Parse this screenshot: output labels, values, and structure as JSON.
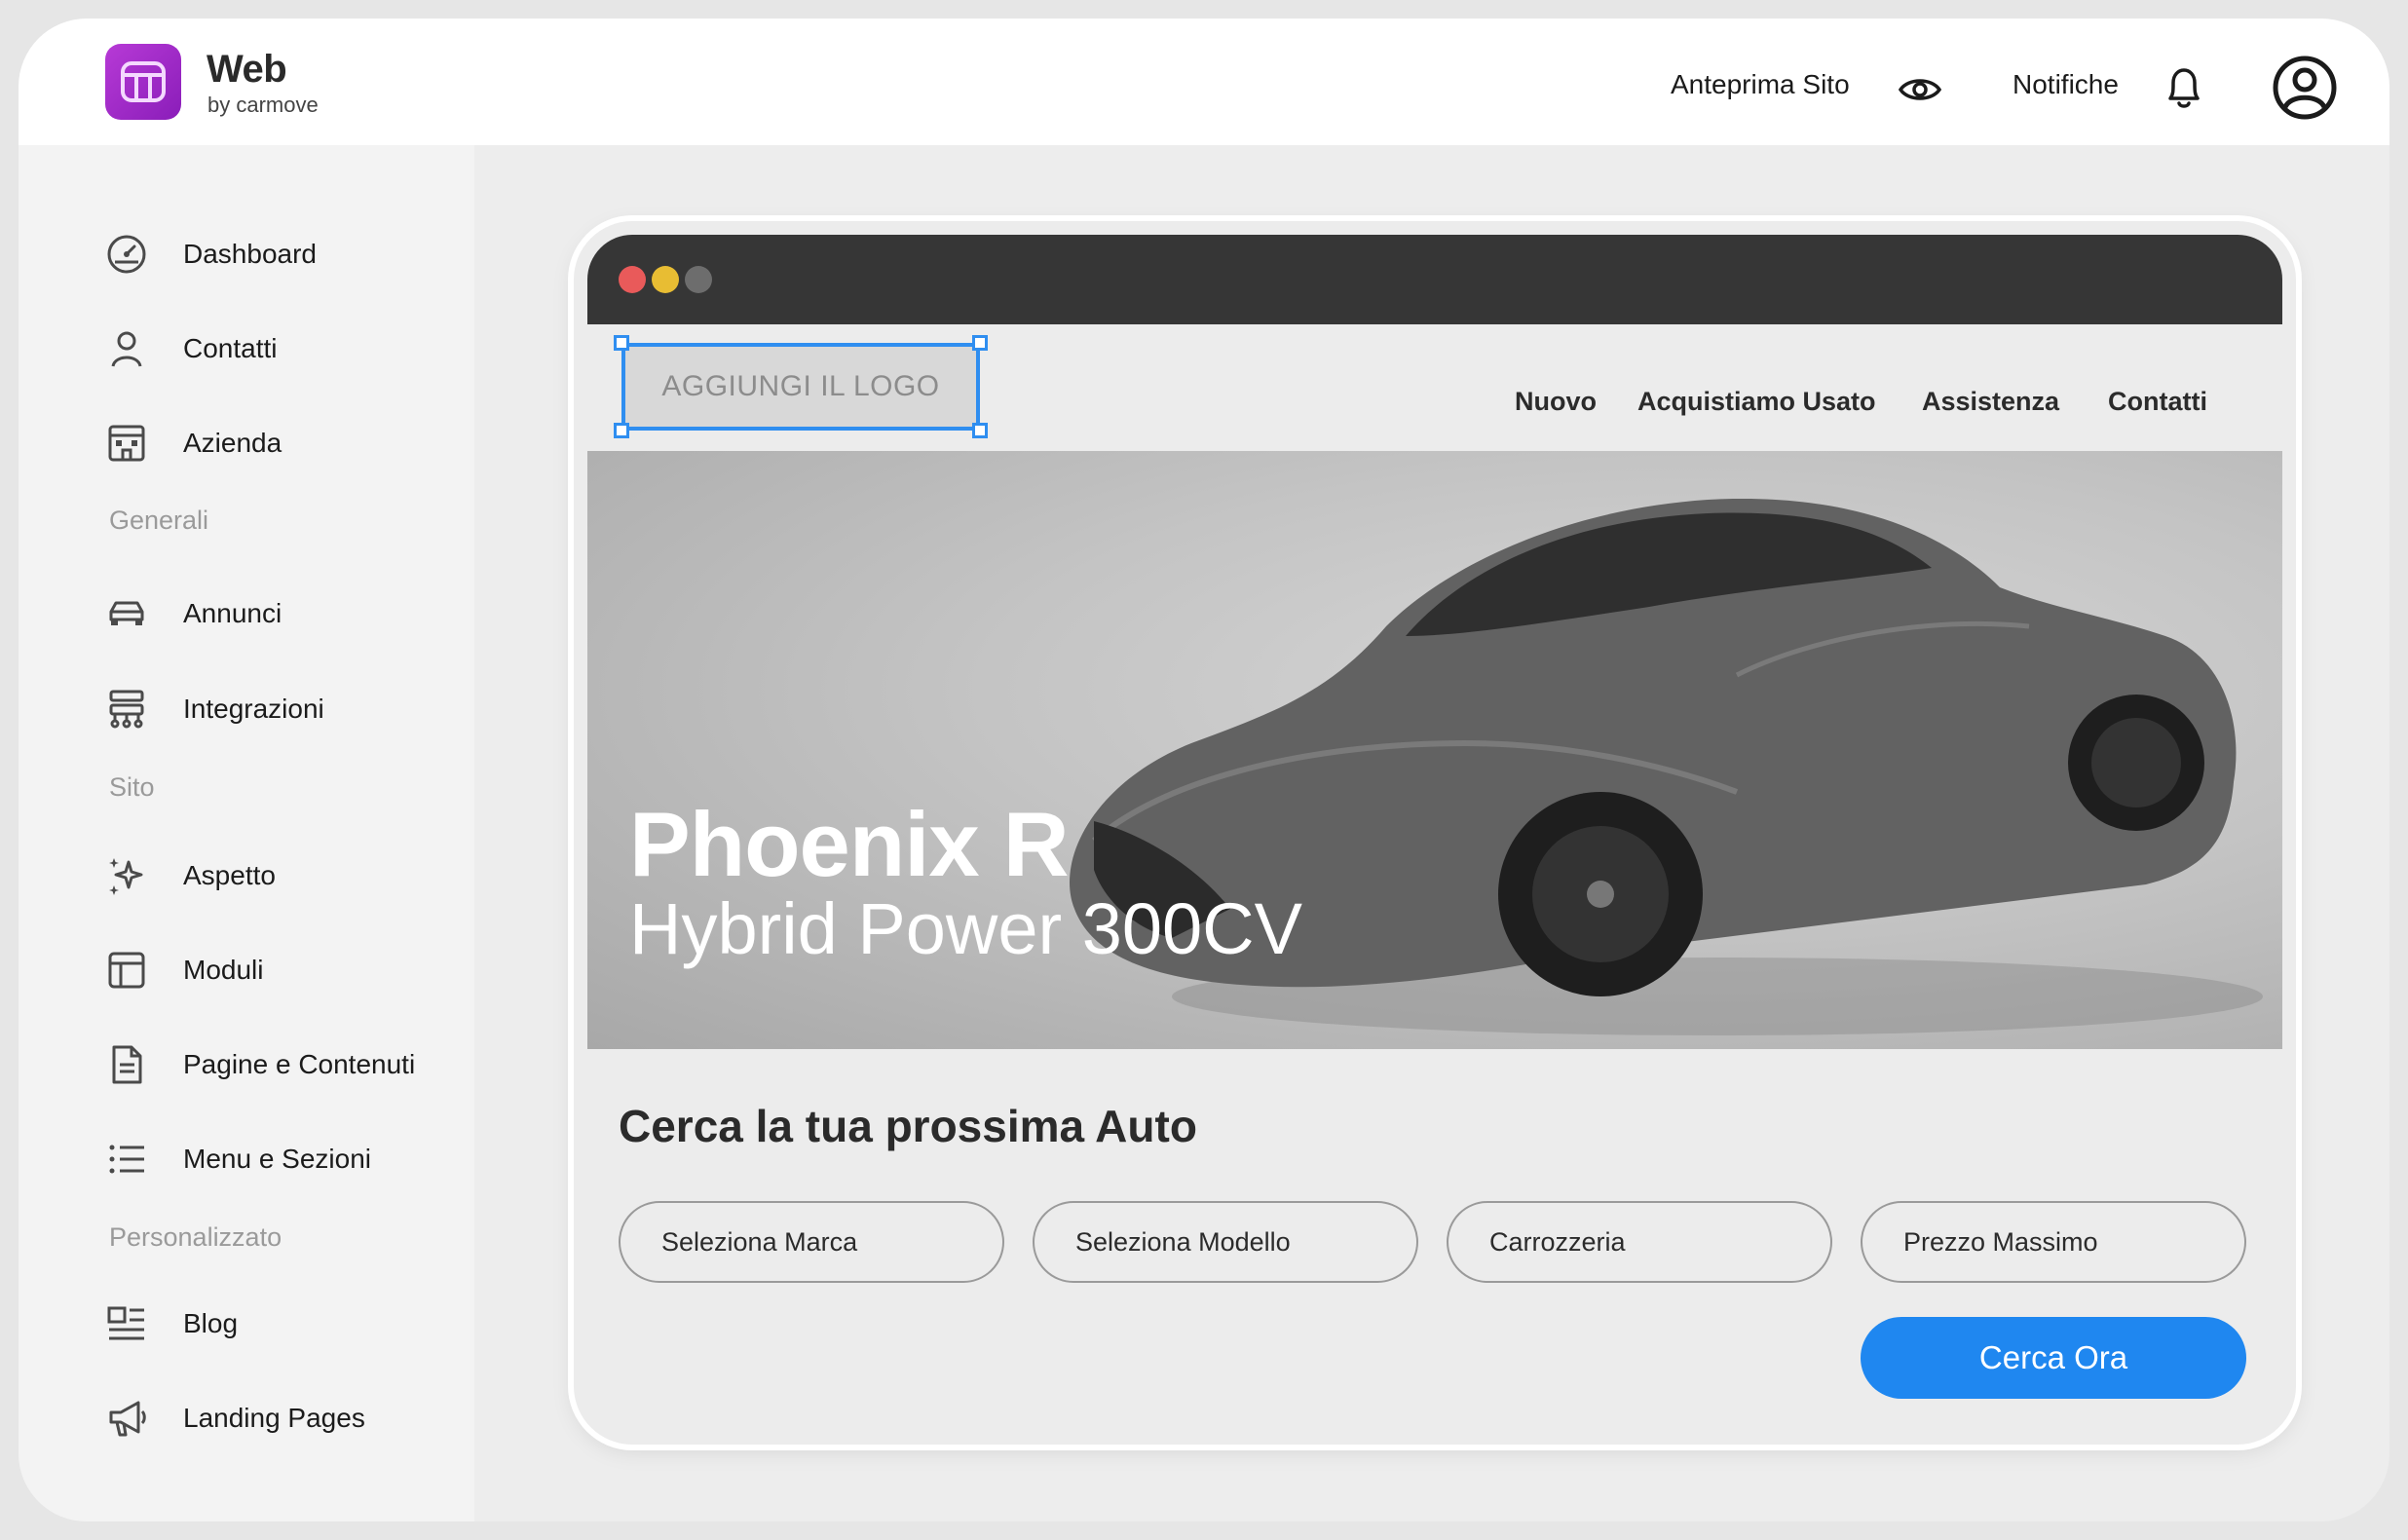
{
  "brand": {
    "name": "Web",
    "sub": "by carmove",
    "accent": "#9b2bc9"
  },
  "topbar": {
    "preview_label": "Anteprima Sito",
    "notifications_label": "Notifiche"
  },
  "sidebar": {
    "items": [
      {
        "label": "Dashboard",
        "icon": "speedometer-icon"
      },
      {
        "label": "Contatti",
        "icon": "user-icon"
      },
      {
        "label": "Azienda",
        "icon": "building-icon"
      },
      {
        "label": "Annunci",
        "icon": "car-icon"
      },
      {
        "label": "Integrazioni",
        "icon": "hierarchy-icon"
      },
      {
        "label": "Aspetto",
        "icon": "sparkles-icon"
      },
      {
        "label": "Moduli",
        "icon": "layout-icon"
      },
      {
        "label": "Pagine e Contenuti",
        "icon": "document-icon"
      },
      {
        "label": "Menu e Sezioni",
        "icon": "list-icon"
      },
      {
        "label": "Blog",
        "icon": "blog-icon"
      },
      {
        "label": "Landing Pages",
        "icon": "megaphone-icon"
      }
    ],
    "sections": {
      "generali": "Generali",
      "sito": "Sito",
      "personalizzato": "Personalizzato"
    }
  },
  "preview": {
    "logo_placeholder": "AGGIUNGI IL LOGO",
    "nav": [
      "Nuovo",
      "Acquistiamo Usato",
      "Assistenza",
      "Contatti"
    ],
    "hero_title": "Phoenix R",
    "hero_subtitle": "Hybrid Power 300CV",
    "search_title": "Cerca la tua prossima Auto",
    "filters": [
      "Seleziona Marca",
      "Seleziona Modello",
      "Carrozzeria",
      "Prezzo Massimo"
    ],
    "cta": "Cerca Ora",
    "cta_color": "#1f87f0"
  }
}
